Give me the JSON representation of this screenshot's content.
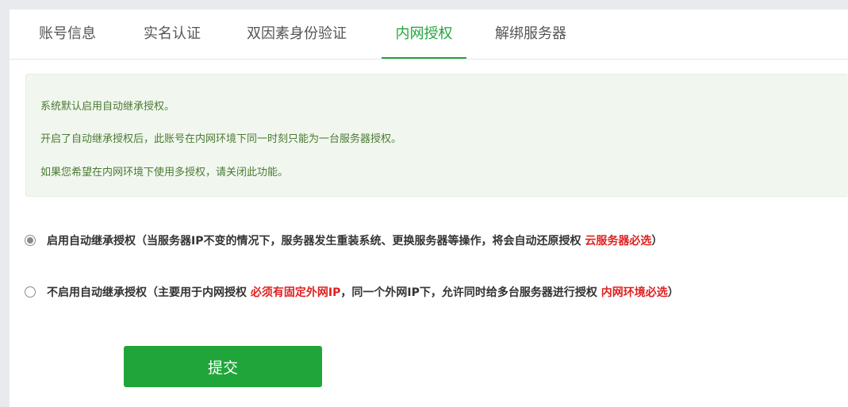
{
  "tabs": [
    {
      "label": "账号信息"
    },
    {
      "label": "实名认证"
    },
    {
      "label": "双因素身份验证"
    },
    {
      "label": "内网授权",
      "active": true
    },
    {
      "label": "解绑服务器"
    }
  ],
  "notice": {
    "line1": "系统默认启用自动继承授权。",
    "line2": "开启了自动继承授权后，此账号在内网环境下同一时刻只能为一台服务器授权。",
    "line3": "如果您希望在内网环境下使用多授权，请关闭此功能。"
  },
  "options": [
    {
      "checked": true,
      "text_a": "启用自动继承授权（当服务器IP不变的情况下，服务器发生重装系统、更换服务器等操作，将会自动还原授权 ",
      "red_a": "云服务器必选",
      "text_b": "）"
    },
    {
      "checked": false,
      "text_a": "不启用自动继承授权（主要用于内网授权 ",
      "red_a": "必须有固定外网IP",
      "text_b": "，同一个外网IP下，允许同时给多台服务器进行授权 ",
      "red_b": "内网环境必选",
      "text_c": "）"
    }
  ],
  "submit_label": "提交",
  "colors": {
    "accent": "#20a53a",
    "notice_text": "#4b7a35",
    "notice_bg": "#f1f7ee",
    "required": "#e02020"
  }
}
